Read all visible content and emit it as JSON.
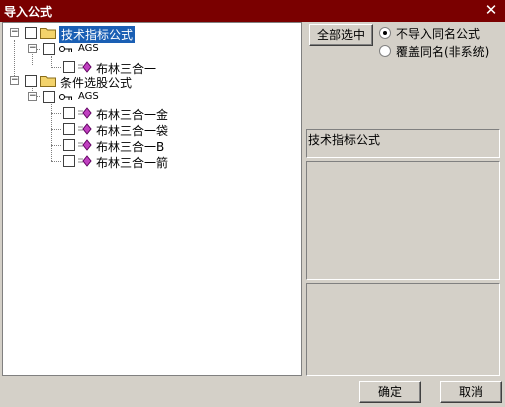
{
  "window": {
    "title": "导入公式"
  },
  "tree": {
    "root1": {
      "label": "技术指标公式"
    },
    "root1_child": {
      "label": "AGS"
    },
    "root1_leaf": {
      "label": "布林三合一"
    },
    "root2": {
      "label": "条件选股公式"
    },
    "root2_child": {
      "label": "AGS"
    },
    "root2_leaves": [
      {
        "label": "布林三合一金"
      },
      {
        "label": "布林三合一袋"
      },
      {
        "label": "布林三合一B"
      },
      {
        "label": "布林三合一箭"
      }
    ]
  },
  "options": {
    "select_all_label": "全部选中",
    "radio_no_import": "不导入同名公式",
    "radio_overwrite": "覆盖同名(非系统)"
  },
  "info": {
    "formula_type": "技术指标公式"
  },
  "footer": {
    "ok_label": "确定",
    "cancel_label": "取消"
  }
}
